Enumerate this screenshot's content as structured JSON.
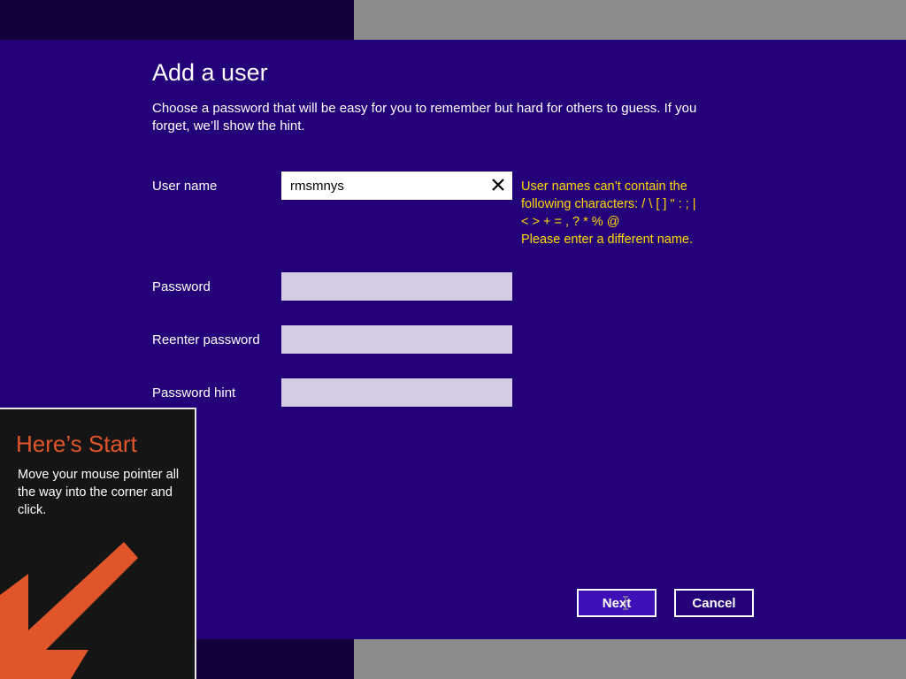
{
  "dialog": {
    "title": "Add a user",
    "description": "Choose a password that will be easy for you to remember but hard for others to guess. If you forget, we’ll show the hint."
  },
  "form": {
    "username_label": "User name",
    "username_value": "rmsmnys",
    "password_label": "Password",
    "reenter_label": "Reenter password",
    "hint_label": "Password hint",
    "error_line1": "User names can’t contain the",
    "error_line2": "following characters: / \\ [ ] \" : ; |",
    "error_line3": "< > + = , ? * % @",
    "error_line4": "Please enter a different name."
  },
  "buttons": {
    "next": "Next",
    "cancel": "Cancel"
  },
  "start_tip": {
    "title": "Here’s Start",
    "text": "Move your mouse pointer all the way into the corner and click."
  },
  "colors": {
    "dialog_bg": "#23007a",
    "error": "#ffd800",
    "start_accent": "#e0562a"
  },
  "icons": {
    "clear": "close-icon",
    "arrow": "arrow-down-left-icon",
    "cursor": "text-cursor-icon"
  }
}
